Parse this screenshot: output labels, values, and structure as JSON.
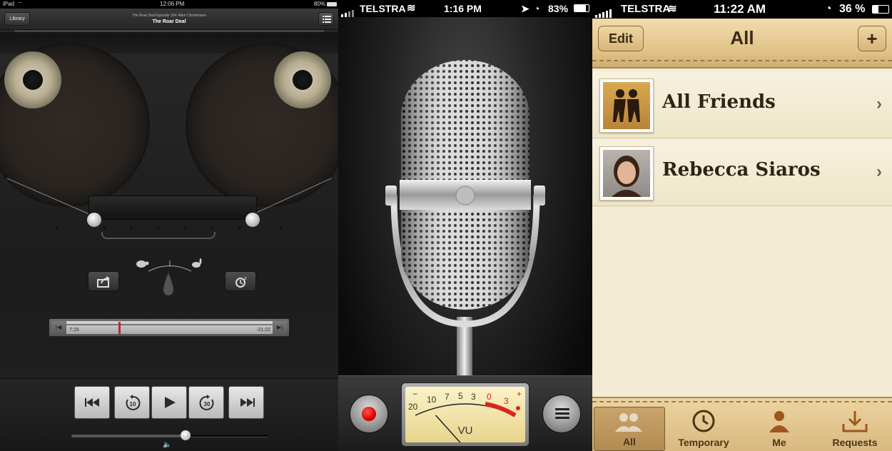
{
  "podcasts": {
    "status": {
      "device": "iPad",
      "time": "12:06 PM",
      "battery": "80%"
    },
    "nav": {
      "library_label": "Library",
      "episode_title": "The Roar Deal Episode 164: Allen Christensen",
      "show_title": "The Roar Deal"
    },
    "scrubber": {
      "elapsed": "7:15",
      "remaining": "-21:22",
      "progress": 0.25
    },
    "controls": {
      "skip_back_seconds": "10",
      "skip_forward_seconds": "30"
    },
    "volume": 0.58,
    "icons": [
      "list-icon",
      "share-icon",
      "sleep-timer-icon",
      "turtle-icon",
      "rabbit-icon",
      "previous-icon",
      "skip-back-icon",
      "play-icon",
      "skip-forward-icon",
      "next-icon",
      "speaker-icon"
    ]
  },
  "voice_memos": {
    "status": {
      "carrier": "TELSTRA",
      "time": "1:16 PM",
      "battery": "83%"
    },
    "vu_meter": {
      "scale": [
        "20",
        "10",
        "7",
        "5",
        "3",
        "0",
        "3"
      ],
      "minus_sign": "−",
      "plus_sign": "+",
      "label": "VU",
      "needle_level": 0.15
    },
    "colors": {
      "record": "#d00000",
      "vu_red": "#d9261c"
    }
  },
  "find_friends": {
    "status": {
      "carrier": "TELSTRA",
      "time": "11:22 AM",
      "battery": "36 %"
    },
    "nav": {
      "edit_label": "Edit",
      "title": "All",
      "add_label": "+"
    },
    "rows": [
      {
        "name": "All Friends",
        "icon": "friends-icon"
      },
      {
        "name": "Rebecca Siaros",
        "icon": "profile-photo"
      }
    ],
    "tabs": [
      {
        "label": "All",
        "icon": "people-icon",
        "active": true
      },
      {
        "label": "Temporary",
        "icon": "clock-icon",
        "active": false
      },
      {
        "label": "Me",
        "icon": "person-icon",
        "active": false
      },
      {
        "label": "Requests",
        "icon": "inbox-download-icon",
        "active": false
      }
    ],
    "colors": {
      "leather": "#d9bb80",
      "paper": "#f3ecd4",
      "text": "#2e2416"
    }
  }
}
